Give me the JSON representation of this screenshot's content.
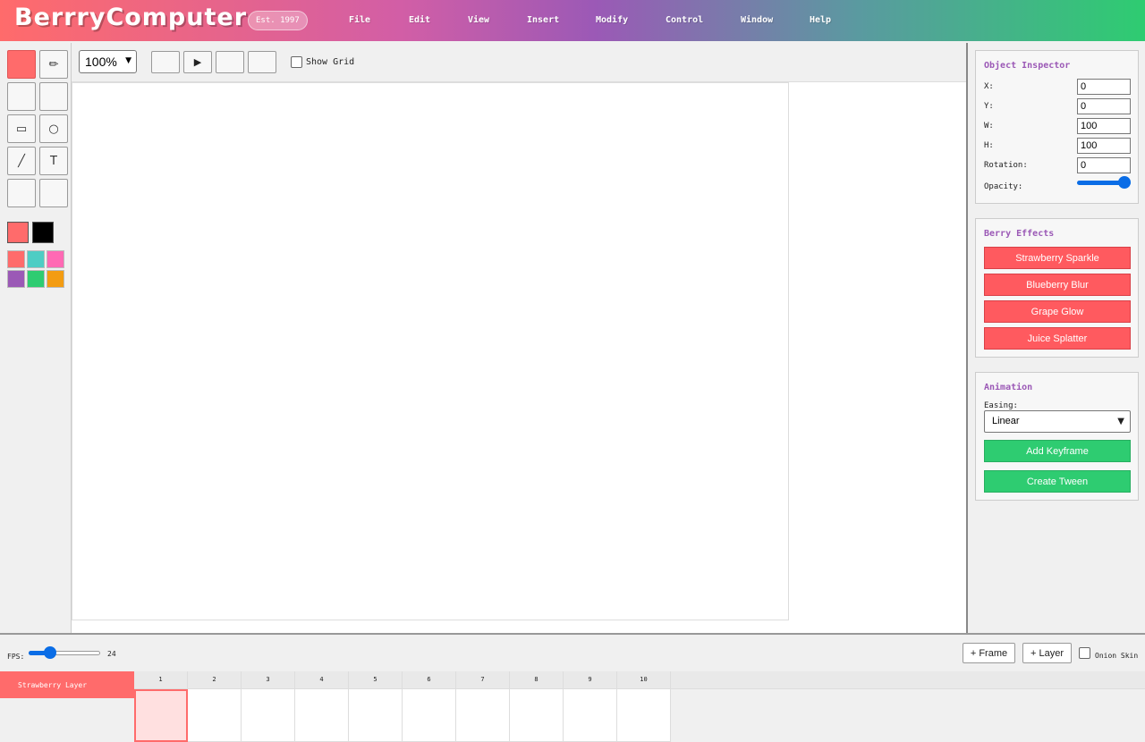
{
  "app": {
    "name": "BerrryComputer",
    "badge": "Est. 1997"
  },
  "menu": [
    "File",
    "Edit",
    "View",
    "Insert",
    "Modify",
    "Control",
    "Window",
    "Help"
  ],
  "tools": [
    {
      "name": "select-tool",
      "glyph": "",
      "active": true
    },
    {
      "name": "pencil-tool",
      "glyph": "✏",
      "active": false
    },
    {
      "name": "brush-tool",
      "glyph": "",
      "active": false
    },
    {
      "name": "eraser-tool",
      "glyph": "",
      "active": false
    },
    {
      "name": "rectangle-tool",
      "glyph": "▭",
      "active": false
    },
    {
      "name": "oval-tool",
      "glyph": "○",
      "active": false
    },
    {
      "name": "line-tool",
      "glyph": "╱",
      "active": false
    },
    {
      "name": "text-tool",
      "glyph": "T",
      "active": false
    },
    {
      "name": "fill-tool",
      "glyph": "",
      "active": false
    },
    {
      "name": "eyedropper-tool",
      "glyph": "",
      "active": false
    }
  ],
  "colors": {
    "fill": "#ff6b6b",
    "stroke": "#000000",
    "palette": [
      "#ff6b6b",
      "#4ecdc4",
      "#ff69b4",
      "#9b59b6",
      "#2ecc71",
      "#f39c12"
    ]
  },
  "topbar": {
    "zoom": "100%",
    "playback": [
      "",
      "▶",
      "",
      ""
    ],
    "show_grid_label": "Show Grid",
    "show_grid_checked": false
  },
  "inspector": {
    "title": "Object Inspector",
    "x_label": "X:",
    "x": "0",
    "y_label": "Y:",
    "y": "0",
    "w_label": "W:",
    "w": "100",
    "h_label": "H:",
    "h": "100",
    "rotation_label": "Rotation:",
    "rotation": "0",
    "opacity_label": "Opacity:",
    "opacity_value": 1.0
  },
  "effects": {
    "title": "Berry Effects",
    "buttons": [
      "Strawberry Sparkle",
      "Blueberry Blur",
      "Grape Glow",
      "Juice Splatter"
    ]
  },
  "animation": {
    "title": "Animation",
    "easing_label": "Easing:",
    "easing": "Linear",
    "add_keyframe": "Add Keyframe",
    "create_tween": "Create Tween"
  },
  "timeline": {
    "fps_label": "FPS:",
    "fps": "24",
    "fps_slider_fraction": 0.25,
    "add_frame": "+ Frame",
    "add_layer": "+ Layer",
    "onion_skin": "Onion Skin",
    "onion_checked": false,
    "layer_name": "Strawberry Layer",
    "frames": [
      "1",
      "2",
      "3",
      "4",
      "5",
      "6",
      "7",
      "8",
      "9",
      "10"
    ],
    "selected_frame": "1"
  }
}
